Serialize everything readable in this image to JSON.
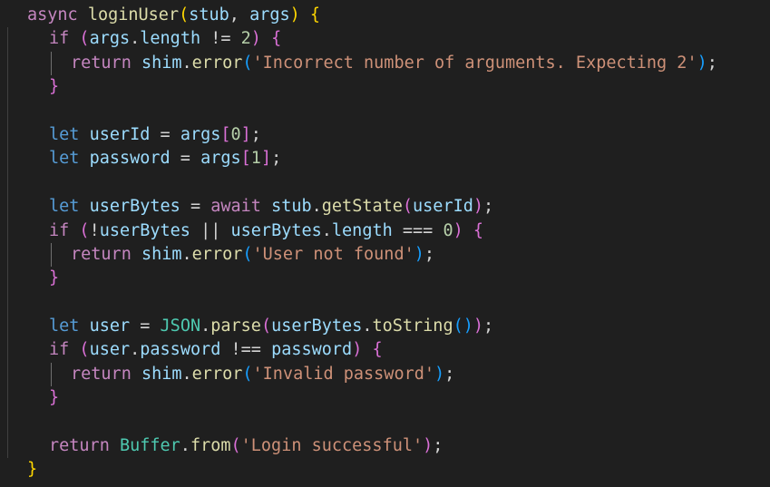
{
  "editor": {
    "language": "javascript",
    "lines": [
      {
        "indent": 1,
        "tokens": [
          [
            "kw",
            "async"
          ],
          [
            "op",
            " "
          ],
          [
            "fn",
            "loginUser"
          ],
          [
            "p0",
            "("
          ],
          [
            "var",
            "stub"
          ],
          [
            "op",
            ", "
          ],
          [
            "var",
            "args"
          ],
          [
            "p0",
            ")"
          ],
          [
            "op",
            " "
          ],
          [
            "p0",
            "{"
          ]
        ]
      },
      {
        "indent": 2,
        "tokens": [
          [
            "kw",
            "if"
          ],
          [
            "op",
            " "
          ],
          [
            "p1",
            "("
          ],
          [
            "var",
            "args"
          ],
          [
            "op",
            "."
          ],
          [
            "var",
            "length"
          ],
          [
            "op",
            " != "
          ],
          [
            "num",
            "2"
          ],
          [
            "p1",
            ")"
          ],
          [
            "op",
            " "
          ],
          [
            "p1",
            "{"
          ]
        ]
      },
      {
        "indent": 3,
        "tokens": [
          [
            "kw",
            "return"
          ],
          [
            "op",
            " "
          ],
          [
            "var",
            "shim"
          ],
          [
            "op",
            "."
          ],
          [
            "fn",
            "error"
          ],
          [
            "p2",
            "("
          ],
          [
            "str",
            "'Incorrect number of arguments. Expecting 2'"
          ],
          [
            "p2",
            ")"
          ],
          [
            "op",
            ";"
          ]
        ]
      },
      {
        "indent": 2,
        "tokens": [
          [
            "p1",
            "}"
          ]
        ]
      },
      {
        "indent": 0,
        "tokens": []
      },
      {
        "indent": 2,
        "tokens": [
          [
            "decl",
            "let"
          ],
          [
            "op",
            " "
          ],
          [
            "var",
            "userId"
          ],
          [
            "op",
            " = "
          ],
          [
            "var",
            "args"
          ],
          [
            "p1",
            "["
          ],
          [
            "num",
            "0"
          ],
          [
            "p1",
            "]"
          ],
          [
            "op",
            ";"
          ]
        ]
      },
      {
        "indent": 2,
        "tokens": [
          [
            "decl",
            "let"
          ],
          [
            "op",
            " "
          ],
          [
            "var",
            "password"
          ],
          [
            "op",
            " = "
          ],
          [
            "var",
            "args"
          ],
          [
            "p1",
            "["
          ],
          [
            "num",
            "1"
          ],
          [
            "p1",
            "]"
          ],
          [
            "op",
            ";"
          ]
        ]
      },
      {
        "indent": 0,
        "tokens": []
      },
      {
        "indent": 2,
        "tokens": [
          [
            "decl",
            "let"
          ],
          [
            "op",
            " "
          ],
          [
            "var",
            "userBytes"
          ],
          [
            "op",
            " = "
          ],
          [
            "kw",
            "await"
          ],
          [
            "op",
            " "
          ],
          [
            "var",
            "stub"
          ],
          [
            "op",
            "."
          ],
          [
            "fn",
            "getState"
          ],
          [
            "p1",
            "("
          ],
          [
            "var",
            "userId"
          ],
          [
            "p1",
            ")"
          ],
          [
            "op",
            ";"
          ]
        ]
      },
      {
        "indent": 2,
        "tokens": [
          [
            "kw",
            "if"
          ],
          [
            "op",
            " "
          ],
          [
            "p1",
            "("
          ],
          [
            "op",
            "!"
          ],
          [
            "var",
            "userBytes"
          ],
          [
            "op",
            " || "
          ],
          [
            "var",
            "userBytes"
          ],
          [
            "op",
            "."
          ],
          [
            "var",
            "length"
          ],
          [
            "op",
            " === "
          ],
          [
            "num",
            "0"
          ],
          [
            "p1",
            ")"
          ],
          [
            "op",
            " "
          ],
          [
            "p1",
            "{"
          ]
        ]
      },
      {
        "indent": 3,
        "tokens": [
          [
            "kw",
            "return"
          ],
          [
            "op",
            " "
          ],
          [
            "var",
            "shim"
          ],
          [
            "op",
            "."
          ],
          [
            "fn",
            "error"
          ],
          [
            "p2",
            "("
          ],
          [
            "str",
            "'User not found'"
          ],
          [
            "p2",
            ")"
          ],
          [
            "op",
            ";"
          ]
        ]
      },
      {
        "indent": 2,
        "tokens": [
          [
            "p1",
            "}"
          ]
        ]
      },
      {
        "indent": 0,
        "tokens": []
      },
      {
        "indent": 2,
        "tokens": [
          [
            "decl",
            "let"
          ],
          [
            "op",
            " "
          ],
          [
            "var",
            "user"
          ],
          [
            "op",
            " = "
          ],
          [
            "cls",
            "JSON"
          ],
          [
            "op",
            "."
          ],
          [
            "fn",
            "parse"
          ],
          [
            "p1",
            "("
          ],
          [
            "var",
            "userBytes"
          ],
          [
            "op",
            "."
          ],
          [
            "fn",
            "toString"
          ],
          [
            "p2",
            "("
          ],
          [
            "p2",
            ")"
          ],
          [
            "p1",
            ")"
          ],
          [
            "op",
            ";"
          ]
        ]
      },
      {
        "indent": 2,
        "tokens": [
          [
            "kw",
            "if"
          ],
          [
            "op",
            " "
          ],
          [
            "p1",
            "("
          ],
          [
            "var",
            "user"
          ],
          [
            "op",
            "."
          ],
          [
            "var",
            "password"
          ],
          [
            "op",
            " !== "
          ],
          [
            "var",
            "password"
          ],
          [
            "p1",
            ")"
          ],
          [
            "op",
            " "
          ],
          [
            "p1",
            "{"
          ]
        ]
      },
      {
        "indent": 3,
        "tokens": [
          [
            "kw",
            "return"
          ],
          [
            "op",
            " "
          ],
          [
            "var",
            "shim"
          ],
          [
            "op",
            "."
          ],
          [
            "fn",
            "error"
          ],
          [
            "p2",
            "("
          ],
          [
            "str",
            "'Invalid password'"
          ],
          [
            "p2",
            ")"
          ],
          [
            "op",
            ";"
          ]
        ]
      },
      {
        "indent": 2,
        "tokens": [
          [
            "p1",
            "}"
          ]
        ]
      },
      {
        "indent": 0,
        "tokens": []
      },
      {
        "indent": 2,
        "tokens": [
          [
            "kw",
            "return"
          ],
          [
            "op",
            " "
          ],
          [
            "cls",
            "Buffer"
          ],
          [
            "op",
            "."
          ],
          [
            "fn",
            "from"
          ],
          [
            "p1",
            "("
          ],
          [
            "str",
            "'Login successful'"
          ],
          [
            "p1",
            ")"
          ],
          [
            "op",
            ";"
          ]
        ]
      },
      {
        "indent": 1,
        "tokens": [
          [
            "p0",
            "}"
          ]
        ]
      }
    ]
  }
}
